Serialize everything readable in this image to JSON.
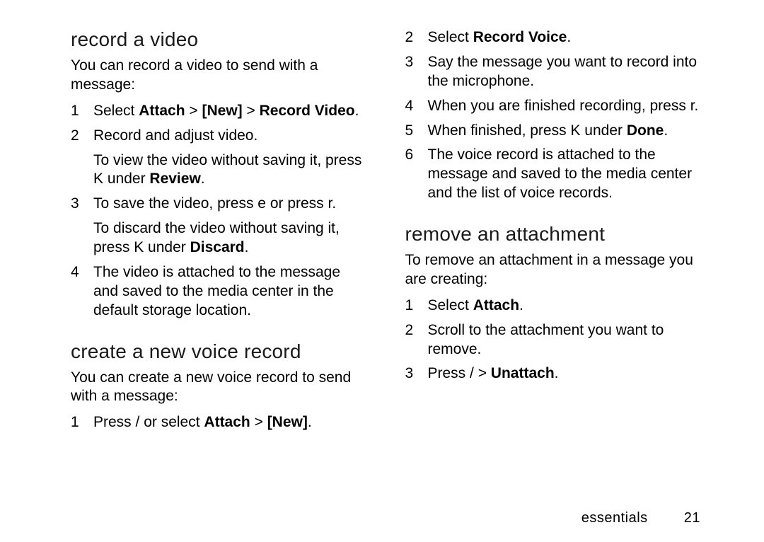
{
  "left": {
    "h1": "record a video",
    "intro1": "You can record a video to send with a message:",
    "s1a": "Select ",
    "s1b": "Attach",
    "s1c": " > ",
    "s1d": "[New]",
    "s1e": " > ",
    "s1f": "Record Video",
    "s1g": ".",
    "s2a": "Record and adjust video.",
    "s2sub_a": "To view the video without saving it, press ",
    "s2sub_b": "K",
    "s2sub_c": " under ",
    "s2sub_d": "Review",
    "s2sub_e": ".",
    "s3a": "To save the video, press ",
    "s3b": "e",
    "s3c": " or press ",
    "s3d": "r",
    "s3e": ".",
    "s3sub_a": "To discard the video without saving it, press ",
    "s3sub_b": "K",
    "s3sub_c": " under ",
    "s3sub_d": "Discard",
    "s3sub_e": ".",
    "s4": "The video is attached to the message and saved to the media center in the default storage location.",
    "h2": "create a new voice record",
    "intro2": "You can create a new voice record to send with a message:",
    "v1a": "Press ",
    "v1b": "/",
    "v1c": " or select ",
    "v1d": "Attach",
    "v1e": " > ",
    "v1f": "[New]",
    "v1g": "."
  },
  "right": {
    "v2a": "Select ",
    "v2b": "Record Voice",
    "v2c": ".",
    "v3": "Say the message you want to record into the microphone.",
    "v4a": "When you are finished recording, press ",
    "v4b": "r",
    "v4c": ".",
    "v5a": "When finished, press ",
    "v5b": "K",
    "v5c": " under ",
    "v5d": "Done",
    "v5e": ".",
    "v6": "The voice record is attached to the message and saved to the media center and the list of voice records.",
    "h3": "remove an attachment",
    "intro3": "To remove an attachment in a message you are creating:",
    "r1a": "Select ",
    "r1b": "Attach",
    "r1c": ".",
    "r2": "Scroll to the attachment you want to remove.",
    "r3a": "Press ",
    "r3b": "/",
    "r3c": " > ",
    "r3d": "Unattach",
    "r3e": "."
  },
  "footer": {
    "section": "essentials",
    "page": "21"
  }
}
